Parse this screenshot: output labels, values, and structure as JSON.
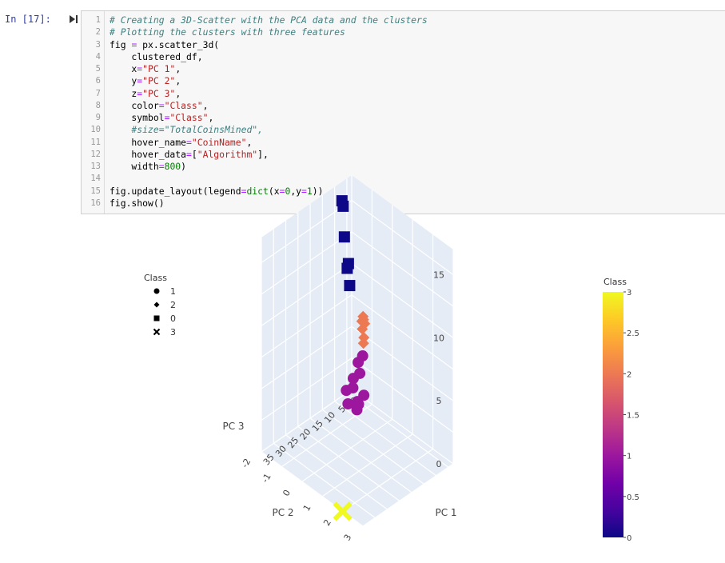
{
  "cell": {
    "prompt": "In [17]:",
    "code_lines": [
      {
        "n": "1",
        "parts": [
          {
            "t": "# Creating a 3D-Scatter with the PCA data and the clusters",
            "c": "cm"
          }
        ]
      },
      {
        "n": "2",
        "parts": [
          {
            "t": "# Plotting the clusters with three features",
            "c": "cm"
          }
        ]
      },
      {
        "n": "3",
        "parts": [
          {
            "t": "fig ",
            "c": ""
          },
          {
            "t": "=",
            "c": "op"
          },
          {
            "t": " px.scatter_3d(",
            "c": ""
          }
        ]
      },
      {
        "n": "4",
        "parts": [
          {
            "t": "    clustered_df,",
            "c": ""
          }
        ]
      },
      {
        "n": "5",
        "parts": [
          {
            "t": "    x",
            "c": ""
          },
          {
            "t": "=",
            "c": "op"
          },
          {
            "t": "\"PC 1\"",
            "c": "st"
          },
          {
            "t": ",",
            "c": ""
          }
        ]
      },
      {
        "n": "6",
        "parts": [
          {
            "t": "    y",
            "c": ""
          },
          {
            "t": "=",
            "c": "op"
          },
          {
            "t": "\"PC 2\"",
            "c": "st"
          },
          {
            "t": ",",
            "c": ""
          }
        ]
      },
      {
        "n": "7",
        "parts": [
          {
            "t": "    z",
            "c": ""
          },
          {
            "t": "=",
            "c": "op"
          },
          {
            "t": "\"PC 3\"",
            "c": "st"
          },
          {
            "t": ",",
            "c": ""
          }
        ]
      },
      {
        "n": "8",
        "parts": [
          {
            "t": "    color",
            "c": ""
          },
          {
            "t": "=",
            "c": "op"
          },
          {
            "t": "\"Class\"",
            "c": "st"
          },
          {
            "t": ",",
            "c": ""
          }
        ]
      },
      {
        "n": "9",
        "parts": [
          {
            "t": "    symbol",
            "c": ""
          },
          {
            "t": "=",
            "c": "op"
          },
          {
            "t": "\"Class\"",
            "c": "st"
          },
          {
            "t": ",",
            "c": ""
          }
        ]
      },
      {
        "n": "10",
        "parts": [
          {
            "t": "    #size=\"TotalCoinsMined\",",
            "c": "cm"
          }
        ]
      },
      {
        "n": "11",
        "parts": [
          {
            "t": "    hover_name",
            "c": ""
          },
          {
            "t": "=",
            "c": "op"
          },
          {
            "t": "\"CoinName\"",
            "c": "st"
          },
          {
            "t": ",",
            "c": ""
          }
        ]
      },
      {
        "n": "12",
        "parts": [
          {
            "t": "    hover_data",
            "c": ""
          },
          {
            "t": "=",
            "c": "op"
          },
          {
            "t": "[",
            "c": ""
          },
          {
            "t": "\"Algorithm\"",
            "c": "st"
          },
          {
            "t": "],",
            "c": ""
          }
        ]
      },
      {
        "n": "13",
        "parts": [
          {
            "t": "    width",
            "c": ""
          },
          {
            "t": "=",
            "c": "op"
          },
          {
            "t": "800",
            "c": "nm"
          },
          {
            "t": ")",
            "c": ""
          }
        ]
      },
      {
        "n": "14",
        "parts": [
          {
            "t": "",
            "c": ""
          }
        ]
      },
      {
        "n": "15",
        "parts": [
          {
            "t": "fig.update_layout(legend",
            "c": ""
          },
          {
            "t": "=",
            "c": "op"
          },
          {
            "t": "dict",
            "c": "nm"
          },
          {
            "t": "(x",
            "c": ""
          },
          {
            "t": "=",
            "c": "op"
          },
          {
            "t": "0",
            "c": "nm"
          },
          {
            "t": ",y",
            "c": ""
          },
          {
            "t": "=",
            "c": "op"
          },
          {
            "t": "1",
            "c": "nm"
          },
          {
            "t": "))",
            "c": ""
          }
        ]
      },
      {
        "n": "16",
        "parts": [
          {
            "t": "fig.show()",
            "c": ""
          }
        ]
      }
    ]
  },
  "chart_data": {
    "type": "scatter",
    "axes": {
      "x": {
        "label": "PC 1",
        "ticks": [
          "0",
          "5",
          "10",
          "15",
          "20",
          "25",
          "30",
          "35"
        ]
      },
      "y": {
        "label": "PC 2",
        "ticks": [
          "-2",
          "-1",
          "0",
          "1",
          "2",
          "3"
        ]
      },
      "z": {
        "label": "PC 3",
        "ticks": [
          "0",
          "5",
          "10",
          "15"
        ]
      }
    },
    "legend": {
      "title": "Class",
      "placement": "top-left",
      "items": [
        {
          "symbol": "circle",
          "label": "1"
        },
        {
          "symbol": "diamond",
          "label": "2"
        },
        {
          "symbol": "square",
          "label": "0"
        },
        {
          "symbol": "x",
          "label": "3"
        }
      ]
    },
    "colorbar": {
      "title": "Class",
      "min": 0,
      "max": 3,
      "ticks": [
        "0",
        "0.5",
        "1",
        "1.5",
        "2",
        "2.5",
        "3"
      ],
      "colors": [
        "#0d0887",
        "#46039f",
        "#7201a8",
        "#9c179e",
        "#bd3786",
        "#d8576b",
        "#ed7953",
        "#fb9f3a",
        "#fdca26",
        "#f0f921"
      ]
    },
    "series": [
      {
        "class": 0,
        "symbol": "square",
        "color": "#0d0887",
        "points": [
          [
            1,
            -2,
            12.5
          ],
          [
            1.5,
            -2,
            15
          ],
          [
            2,
            -2,
            15.5
          ],
          [
            4,
            -1.5,
            11
          ],
          [
            3,
            -1.5,
            9.5
          ],
          [
            6,
            -1.2,
            12
          ]
        ]
      },
      {
        "class": 1,
        "symbol": "circle",
        "color": "#9c179e",
        "points": [
          [
            6,
            -0.5,
            5.5
          ],
          [
            7,
            -0.6,
            5
          ],
          [
            8,
            -0.4,
            4.5
          ],
          [
            9,
            -0.6,
            4
          ],
          [
            10,
            -0.5,
            3.5
          ],
          [
            8,
            -0.2,
            3
          ],
          [
            11,
            -0.7,
            3.2
          ],
          [
            9,
            -0.4,
            2.4
          ],
          [
            10,
            -0.3,
            2
          ],
          [
            12,
            -0.5,
            2.5
          ],
          [
            11,
            -0.1,
            2.8
          ]
        ]
      },
      {
        "class": 2,
        "symbol": "diamond",
        "color": "#ed7953",
        "points": [
          [
            -2,
            -1.5,
            6
          ],
          [
            -1,
            -1.3,
            6.5
          ],
          [
            0,
            -1.2,
            7
          ],
          [
            1,
            -1,
            6.8
          ],
          [
            2,
            -1,
            6.5
          ],
          [
            3,
            -0.8,
            6.2
          ],
          [
            4,
            -0.7,
            6
          ]
        ]
      },
      {
        "class": 3,
        "symbol": "x",
        "color": "#f0f921",
        "points": [
          [
            35,
            2,
            0
          ]
        ]
      }
    ]
  }
}
